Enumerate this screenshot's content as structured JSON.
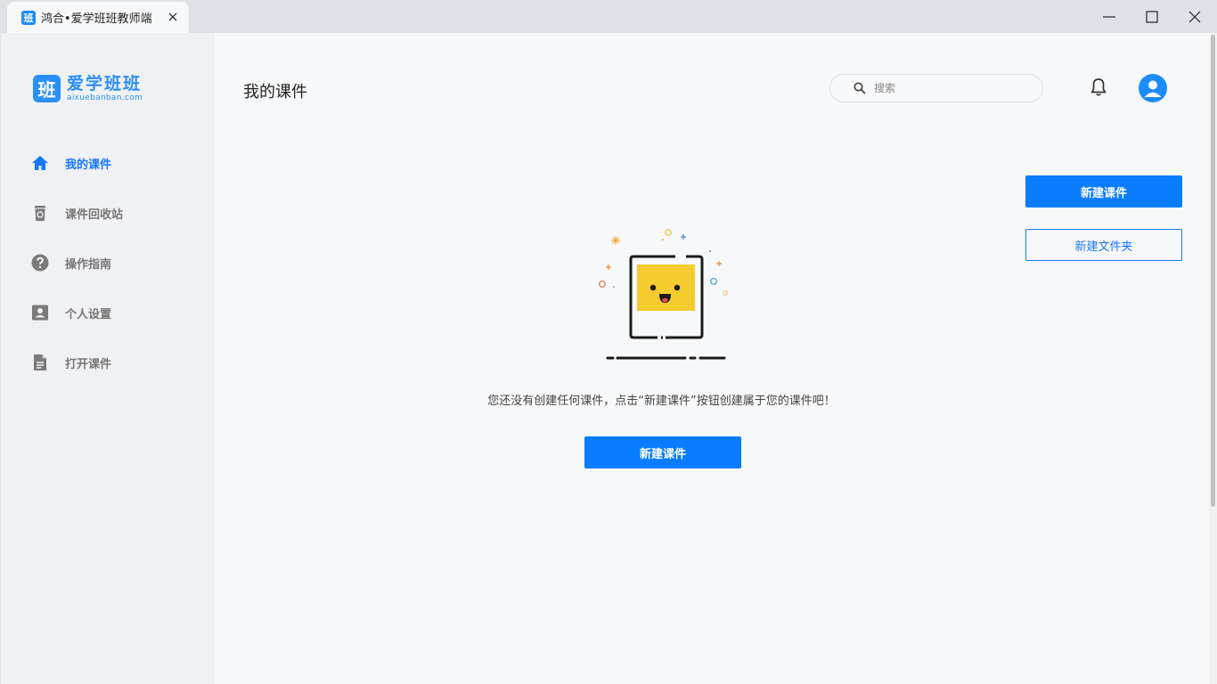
{
  "window": {
    "tab_icon_text": "班",
    "tab_title": "鸿合•爱学班班教师端"
  },
  "sidebar": {
    "logo_mark": "班",
    "logo_cn": "爱学班班",
    "logo_en": "aixuebanban.com",
    "items": [
      {
        "label": "我的课件",
        "icon": "home-icon",
        "active": true
      },
      {
        "label": "课件回收站",
        "icon": "trash-icon",
        "active": false
      },
      {
        "label": "操作指南",
        "icon": "help-icon",
        "active": false
      },
      {
        "label": "个人设置",
        "icon": "profile-icon",
        "active": false
      },
      {
        "label": "打开课件",
        "icon": "document-icon",
        "active": false
      }
    ]
  },
  "header": {
    "title": "我的课件",
    "search_placeholder": "搜索"
  },
  "actions": {
    "new_courseware": "新建课件",
    "new_folder": "新建文件夹"
  },
  "empty_state": {
    "message": "您还没有创建任何课件，点击“新建课件”按钮创建属于您的课件吧！",
    "button": "新建课件"
  },
  "colors": {
    "accent": "#0a7cff",
    "sidebar_bg": "#f0f1f4",
    "main_bg": "#f7f8fa"
  }
}
